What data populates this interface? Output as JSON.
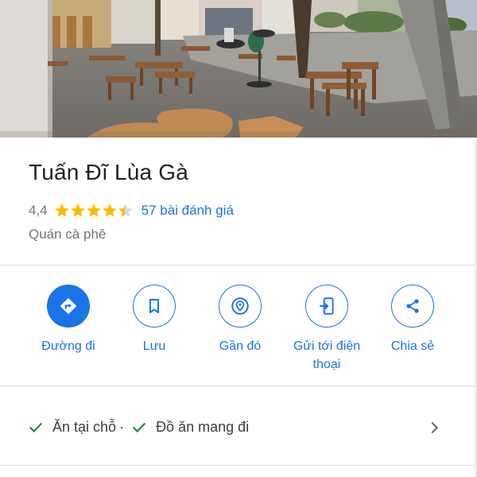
{
  "place": {
    "name": "Tuấn Đĩ Lùa Gà",
    "rating": "4,4",
    "rating_value": 4.4,
    "reviews_label": "57 bài đánh giá",
    "category": "Quán cà phê"
  },
  "actions": [
    {
      "label": "Đường đi",
      "icon": "directions-icon"
    },
    {
      "label": "Lưu",
      "icon": "bookmark-icon"
    },
    {
      "label": "Gần đó",
      "icon": "nearby-icon"
    },
    {
      "label": "Gửi tới điện thoại",
      "icon": "send-to-phone-icon"
    },
    {
      "label": "Chia sẻ",
      "icon": "share-icon"
    }
  ],
  "service_options": [
    {
      "label": "Ăn tại chỗ"
    },
    {
      "label": "Đồ ăn mang đi"
    }
  ],
  "service_separator": "·",
  "colors": {
    "accent": "#1a73e8",
    "star": "#fbbc04",
    "text_primary": "#202124",
    "text_secondary": "#70757a",
    "check": "#188038"
  }
}
